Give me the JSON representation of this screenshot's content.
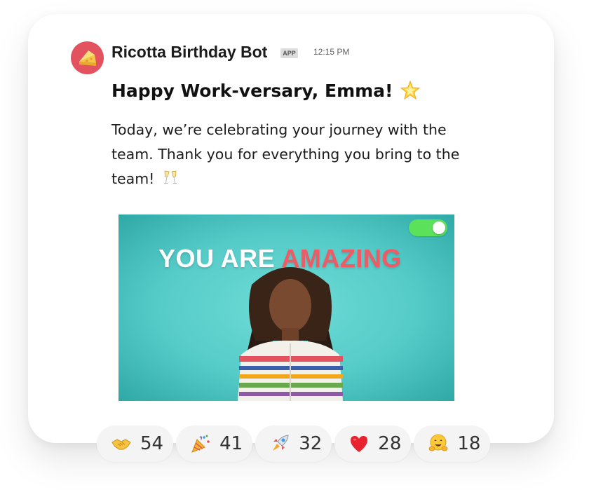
{
  "message": {
    "sender": "Ricotta Birthday Bot",
    "badge": "APP",
    "time": "12:15 PM",
    "avatar_icon": "cheese-icon",
    "avatar_color": "#e2535f",
    "headline": "Happy Work-versary, Emma!",
    "headline_icon": "star-icon",
    "body": "Today, we’re celebrating your journey with the team. Thank you for everything you bring to the team!",
    "body_icon": "champagne-icon"
  },
  "gif": {
    "title_white": "YOU ARE ",
    "title_red": "AMAZING",
    "background": "#55cbc8",
    "accent": "#ef5a65",
    "toggle_on": true,
    "toggle_color": "#5be15a"
  },
  "reactions": [
    {
      "icon": "handshake-icon",
      "count": "54"
    },
    {
      "icon": "party-popper-icon",
      "count": "41"
    },
    {
      "icon": "rocket-icon",
      "count": "32"
    },
    {
      "icon": "heart-icon",
      "count": "28"
    },
    {
      "icon": "hugging-face-icon",
      "count": "18"
    }
  ]
}
